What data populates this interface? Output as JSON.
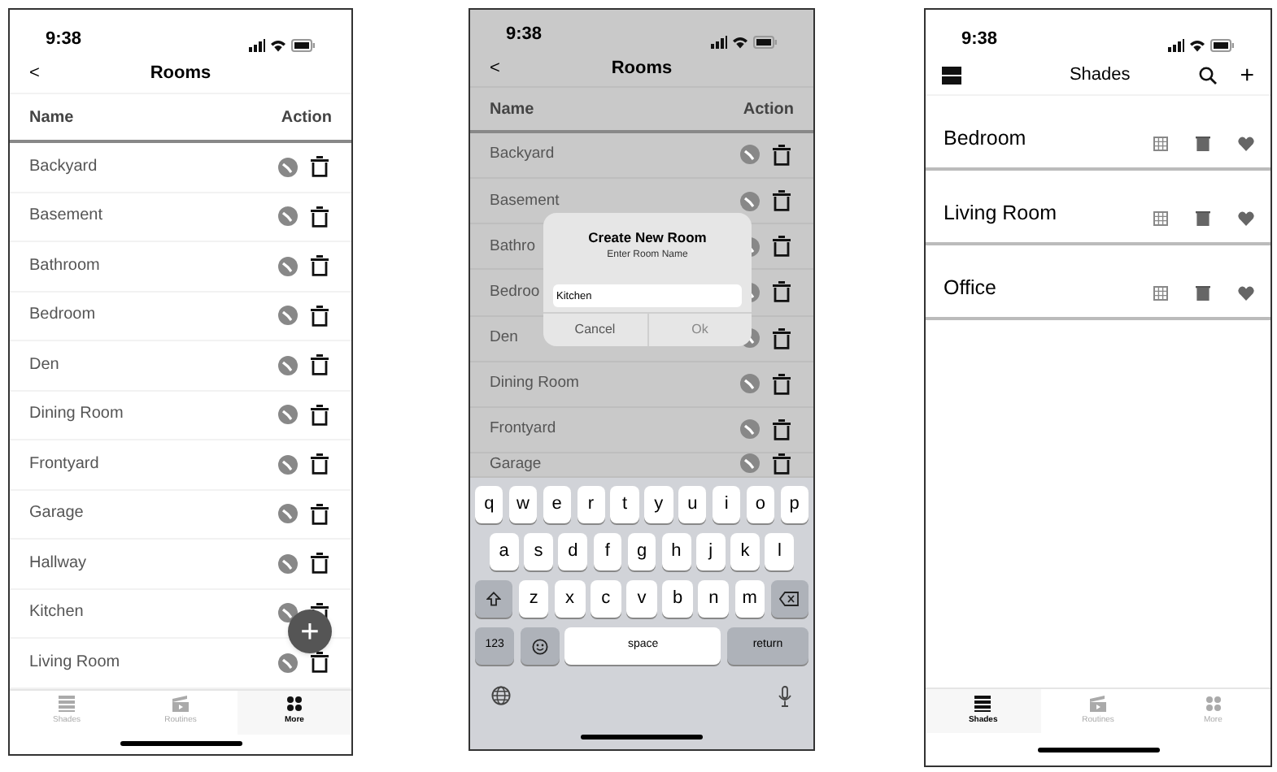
{
  "screens": [
    {
      "kind": "rooms",
      "status_bar": {
        "time": "9:38"
      },
      "header": {
        "back": "<",
        "title": "Rooms"
      },
      "columns": [
        "Name",
        "Action"
      ],
      "rows": [
        {
          "name": "Backyard"
        },
        {
          "name": "Basement"
        },
        {
          "name": "Bathroom"
        },
        {
          "name": "Bedroom"
        },
        {
          "name": "Den"
        },
        {
          "name": "Dining Room"
        },
        {
          "name": "Frontyard"
        },
        {
          "name": "Garage"
        },
        {
          "name": "Hallway"
        },
        {
          "name": "Kitchen"
        },
        {
          "name": "Living Room"
        }
      ],
      "fab": "+",
      "tab_bar": [
        {
          "label": "Shades",
          "selected": false
        },
        {
          "label": "Routines",
          "selected": false
        },
        {
          "label": "More",
          "selected": true
        }
      ]
    },
    {
      "kind": "rooms_dialog",
      "status_bar": {
        "time": "9:38"
      },
      "header": {
        "back": "<",
        "title": "Rooms"
      },
      "columns": [
        "Name",
        "Action"
      ],
      "rows": [
        {
          "name": "Backyard"
        },
        {
          "name": "Basement"
        },
        {
          "name": "Bathro"
        },
        {
          "name": "Bedroo"
        },
        {
          "name": "Den"
        },
        {
          "name": "Dining Room"
        },
        {
          "name": "Frontyard"
        },
        {
          "name": "Garage"
        }
      ],
      "dialog": {
        "title": "Create New Room",
        "message": "Enter Room Name",
        "value": "Kitchen",
        "buttons": [
          "Cancel",
          "Ok"
        ]
      },
      "keyboard": {
        "rows": [
          {
            "keys": [
              {
                "kind": "char",
                "label": "q"
              },
              {
                "kind": "char",
                "label": "w"
              },
              {
                "kind": "char",
                "label": "e"
              },
              {
                "kind": "char",
                "label": "r"
              },
              {
                "kind": "char",
                "label": "t"
              },
              {
                "kind": "char",
                "label": "y"
              },
              {
                "kind": "char",
                "label": "u"
              },
              {
                "kind": "char",
                "label": "i"
              },
              {
                "kind": "char",
                "label": "o"
              },
              {
                "kind": "char",
                "label": "p"
              }
            ]
          },
          {
            "keys": [
              {
                "kind": "char",
                "label": "a"
              },
              {
                "kind": "char",
                "label": "s"
              },
              {
                "kind": "char",
                "label": "d"
              },
              {
                "kind": "char",
                "label": "f"
              },
              {
                "kind": "char",
                "label": "g"
              },
              {
                "kind": "char",
                "label": "h"
              },
              {
                "kind": "char",
                "label": "j"
              },
              {
                "kind": "char",
                "label": "k"
              },
              {
                "kind": "char",
                "label": "l"
              }
            ]
          },
          {
            "keys": [
              {
                "kind": "shift"
              },
              {
                "kind": "char",
                "label": "z"
              },
              {
                "kind": "char",
                "label": "x"
              },
              {
                "kind": "char",
                "label": "c"
              },
              {
                "kind": "char",
                "label": "v"
              },
              {
                "kind": "char",
                "label": "b"
              },
              {
                "kind": "char",
                "label": "n"
              },
              {
                "kind": "char",
                "label": "m"
              },
              {
                "kind": "delete"
              }
            ]
          },
          {
            "keys": [
              {
                "kind": "mode",
                "label": "123"
              },
              {
                "kind": "emoji"
              },
              {
                "kind": "space",
                "label": "space"
              },
              {
                "kind": "mode",
                "label": "return"
              }
            ]
          }
        ]
      }
    },
    {
      "kind": "shades",
      "status_bar": {
        "time": "9:38"
      },
      "header": {
        "title": "Shades",
        "add": "+"
      },
      "rows": [
        {
          "name": "Bedroom"
        },
        {
          "name": "Living Room"
        },
        {
          "name": "Office"
        }
      ],
      "tab_bar": [
        {
          "label": "Shades",
          "selected": true
        },
        {
          "label": "Routines",
          "selected": false
        },
        {
          "label": "More",
          "selected": false
        }
      ]
    }
  ]
}
